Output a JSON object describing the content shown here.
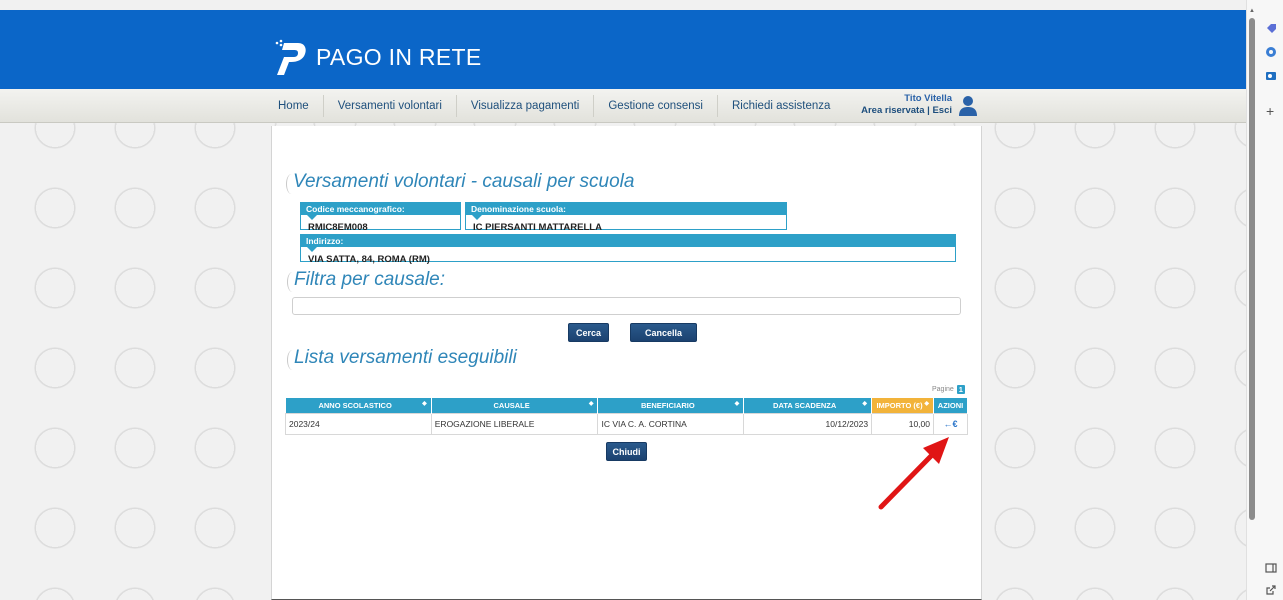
{
  "header": {
    "logo_text": "PAGO IN RETE",
    "brand_color": "#0b66c8"
  },
  "nav": {
    "items": [
      {
        "label": "Home"
      },
      {
        "label": "Versamenti volontari"
      },
      {
        "label": "Visualizza pagamenti"
      },
      {
        "label": "Gestione consensi"
      },
      {
        "label": "Richiedi assistenza"
      }
    ]
  },
  "user": {
    "name": "Tito Vitella",
    "area_label": "Area riservata",
    "separator": " | ",
    "logout_label": "Esci"
  },
  "page": {
    "title": "Versamenti volontari - causali per scuola",
    "codice_label": "Codice meccanografico:",
    "codice_value": "RMIC8EM008",
    "denominazione_label": "Denominazione scuola:",
    "denominazione_value": "IC PIERSANTI MATTARELLA",
    "indirizzo_label": "Indirizzo:",
    "indirizzo_value": "VIA SATTA, 84, ROMA (RM)",
    "filter_title": "Filtra per causale:",
    "filter_value": "",
    "search_button": "Cerca",
    "clear_button": "Cancella",
    "list_title": "Lista versamenti eseguibili",
    "pages_label": "Pagine",
    "current_page": "1",
    "close_button": "Chiudi"
  },
  "table": {
    "headers": [
      "ANNO SCOLASTICO",
      "CAUSALE",
      "BENEFICIARIO",
      "DATA SCADENZA",
      "IMPORTO (€)",
      "AZIONI"
    ],
    "rows": [
      {
        "anno": "2023/24",
        "causale": "EROGAZIONE LIBERALE",
        "beneficiario": "IC VIA C. A. CORTINA",
        "scadenza": "10/12/2023",
        "importo": "10,00",
        "azione": "€"
      }
    ]
  },
  "colors": {
    "accent": "#2da0c8",
    "import_header": "#f2b33a",
    "button": "#1c4270",
    "annotation_arrow": "#e01515"
  }
}
